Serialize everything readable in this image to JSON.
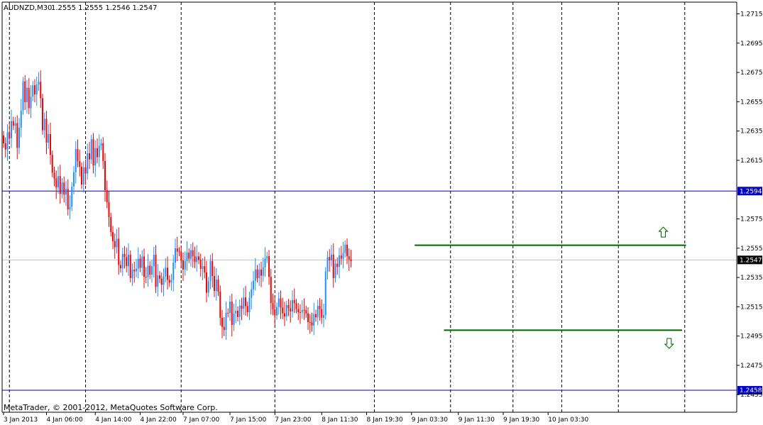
{
  "header": {
    "symbol": "AUDNZD,M30",
    "ohlc": "1.2555 1.2555 1.2546 1.2547"
  },
  "footer": {
    "copyright": "MetaTrader, © 2001-2012, MetaQuotes Software Corp."
  },
  "colors": {
    "background": "#ffffff",
    "bull": "#1e90ff",
    "bear": "#ff0000",
    "grid": "#000000",
    "hline": "#0000cd",
    "bid_line": "#c0c0c0",
    "channel": "#006400",
    "tag_bg": "#0000cd"
  },
  "chart_data": {
    "type": "candlestick",
    "timeframe": "M30",
    "ylim": [
      1.2443,
      1.2723
    ],
    "y_ticks": [
      "1.2715",
      "1.2695",
      "1.2675",
      "1.2655",
      "1.2635",
      "1.2615",
      "1.2575",
      "1.2555",
      "1.2535",
      "1.2515",
      "1.2495",
      "1.2475",
      "1.2455"
    ],
    "x_ticks": [
      "3 Jan 2013",
      "4 Jan 06:00",
      "4 Jan 14:00",
      "4 Jan 22:00",
      "7 Jan 07:00",
      "7 Jan 15:00",
      "7 Jan 23:00",
      "8 Jan 11:30",
      "8 Jan 19:30",
      "9 Jan 03:30",
      "9 Jan 11:30",
      "9 Jan 19:30",
      "10 Jan 03:30"
    ],
    "vertical_grid_positions": [
      3,
      42,
      91,
      139,
      190,
      229,
      261,
      286,
      315,
      349
    ],
    "horizontal_lines": [
      {
        "price": 1.2594,
        "label": "1.2594"
      },
      {
        "price": 1.2458,
        "label": "1.2458"
      }
    ],
    "bid_line": {
      "price": 1.2547,
      "label": "1.2547"
    },
    "channel_lines": [
      {
        "name": "resistance",
        "price": 1.2557,
        "from_bar": 211,
        "to_bar": 350
      },
      {
        "name": "support",
        "price": 1.2499,
        "from_bar": 226,
        "to_bar": 348
      }
    ],
    "arrows": [
      {
        "direction": "up",
        "bar": 338,
        "price": 1.2566
      },
      {
        "direction": "down",
        "bar": 341,
        "price": 1.249
      }
    ],
    "segments": [
      {
        "bars": 6,
        "prices": [
          1.2632,
          1.2626,
          1.2636,
          1.263,
          1.264,
          1.2635
        ]
      },
      {
        "bars": 12,
        "prices": [
          1.2635,
          1.2628,
          1.264,
          1.265,
          1.2668,
          1.2652,
          1.266,
          1.2656,
          1.2662,
          1.2668,
          1.266,
          1.2665
        ]
      },
      {
        "bars": 16,
        "prices": [
          1.2665,
          1.2652,
          1.264,
          1.2646,
          1.2628,
          1.2632,
          1.2616,
          1.2602,
          1.2608,
          1.26,
          1.2606,
          1.2592,
          1.2598,
          1.2588,
          1.259,
          1.2586
        ]
      },
      {
        "bars": 16,
        "prices": [
          1.2586,
          1.2598,
          1.2606,
          1.262,
          1.261,
          1.2616,
          1.2602,
          1.2612,
          1.2606,
          1.2618,
          1.2612,
          1.2624,
          1.2616,
          1.2626,
          1.2618,
          1.2624
        ]
      },
      {
        "bars": 18,
        "prices": [
          1.2624,
          1.261,
          1.26,
          1.259,
          1.2578,
          1.2566,
          1.2558,
          1.2552,
          1.2556,
          1.2548,
          1.2544,
          1.2552,
          1.2548,
          1.254,
          1.2546,
          1.254,
          1.2544,
          1.2541
        ]
      },
      {
        "bars": 18,
        "prices": [
          1.2541,
          1.2546,
          1.2538,
          1.2544,
          1.254,
          1.2538,
          1.2544,
          1.2536,
          1.254,
          1.2546,
          1.2534,
          1.254,
          1.2536,
          1.253,
          1.2534,
          1.2538,
          1.2528,
          1.2536
        ]
      },
      {
        "bars": 16,
        "prices": [
          1.2536,
          1.2546,
          1.2554,
          1.255,
          1.2548,
          1.2552,
          1.2544,
          1.2548,
          1.2552,
          1.2546,
          1.255,
          1.2544,
          1.255,
          1.2552,
          1.2548,
          1.254
        ]
      },
      {
        "bars": 17,
        "prices": [
          1.254,
          1.2534,
          1.253,
          1.2536,
          1.2548,
          1.2536,
          1.2524,
          1.253,
          1.252,
          1.2512,
          1.2504,
          1.25,
          1.251,
          1.2508,
          1.2514,
          1.2508,
          1.2514
        ]
      },
      {
        "bars": 16,
        "prices": [
          1.2514,
          1.2508,
          1.2514,
          1.251,
          1.2516,
          1.252,
          1.2514,
          1.2522,
          1.2526,
          1.253,
          1.2536,
          1.254,
          1.2544,
          1.2538,
          1.2542,
          1.2546
        ]
      },
      {
        "bars": 18,
        "prices": [
          1.2546,
          1.253,
          1.2522,
          1.2516,
          1.251,
          1.2514,
          1.2518,
          1.251,
          1.2516,
          1.2512,
          1.2518,
          1.2514,
          1.251,
          1.2516,
          1.2512,
          1.2518,
          1.2514,
          1.2512
        ]
      },
      {
        "bars": 11,
        "prices": [
          1.2512,
          1.251,
          1.2506,
          1.251,
          1.2508,
          1.2504,
          1.251,
          1.2506,
          1.2512,
          1.2508,
          1.2512
        ]
      },
      {
        "bars": 15,
        "prices": [
          1.2512,
          1.254,
          1.2548,
          1.2544,
          1.2546,
          1.254,
          1.2548,
          1.2544,
          1.255,
          1.2546,
          1.2548,
          1.2552,
          1.2554,
          1.255,
          1.2547
        ]
      }
    ]
  }
}
